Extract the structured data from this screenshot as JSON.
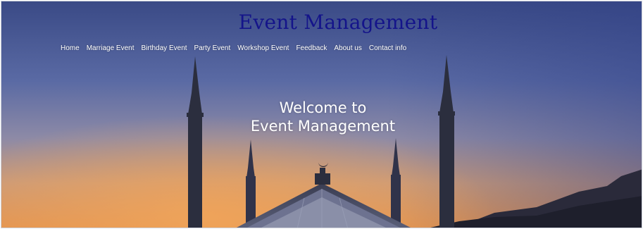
{
  "header": {
    "title": "Event Management"
  },
  "nav": {
    "items": [
      {
        "label": "Home"
      },
      {
        "label": "Marriage Event"
      },
      {
        "label": "Birthday Event"
      },
      {
        "label": "Party Event"
      },
      {
        "label": "Workshop Event"
      },
      {
        "label": "Feedback"
      },
      {
        "label": "About us"
      },
      {
        "label": "Contact info"
      }
    ]
  },
  "hero": {
    "line1": "Welcome to",
    "line2": "Event Management",
    "image": "mosque-silhouette-at-sunset"
  },
  "colors": {
    "title": "#14148a",
    "nav_text": "#ffffff",
    "sky_top": "#3f4f8a",
    "sky_bottom": "#e0955a"
  }
}
